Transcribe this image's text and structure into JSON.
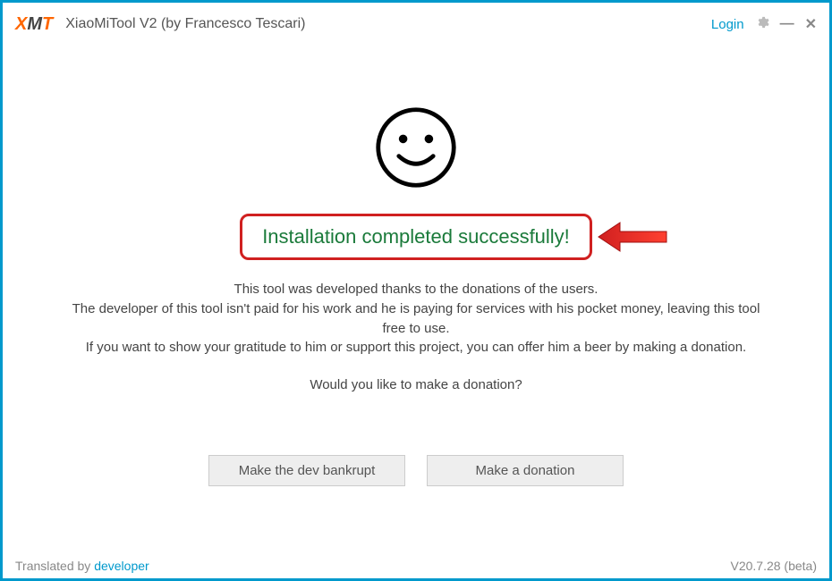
{
  "titlebar": {
    "logo_x": "X",
    "logo_m": "M",
    "logo_t": "T",
    "app_title": "XiaoMiTool V2 (by Francesco Tescari)",
    "login": "Login"
  },
  "main": {
    "success_message": "Installation completed successfully!",
    "desc_line1": "This tool was developed thanks to the donations of the users.",
    "desc_line2": "The developer of this tool isn't paid for his work and he is paying for services with his pocket money, leaving this tool free to use.",
    "desc_line3": "If you want to show your gratitude to him or support this project, you can offer him a beer by making a donation.",
    "donation_question": "Would you like to make a donation?"
  },
  "buttons": {
    "bankrupt": "Make the dev bankrupt",
    "donate": "Make a donation"
  },
  "footer": {
    "translated_by_label": "Translated by ",
    "translated_by_link": "developer",
    "version": "V20.7.28 (beta)"
  }
}
